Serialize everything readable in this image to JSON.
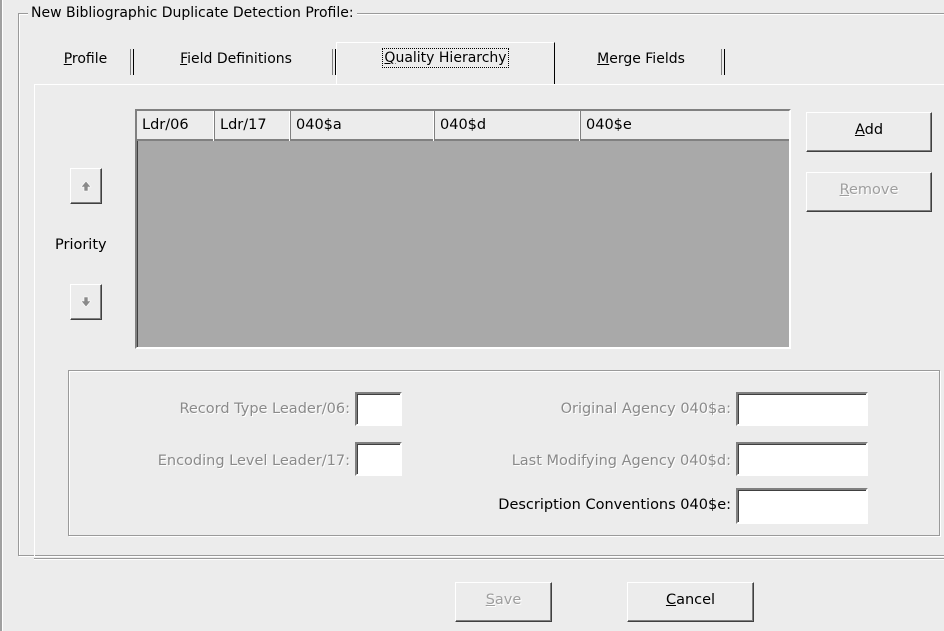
{
  "group_title": "New Bibliographic Duplicate Detection Profile:",
  "tabs": [
    {
      "label": "Profile",
      "mnemonic": "P",
      "rest": "rofile"
    },
    {
      "label": "Field Definitions",
      "mnemonic": "F",
      "rest": "ield Definitions"
    },
    {
      "label": "Quality Hierarchy",
      "mnemonic": "Q",
      "rest": "uality Hierarchy"
    },
    {
      "label": "Merge Fields",
      "mnemonic": "M",
      "rest": "erge Fields"
    }
  ],
  "active_tab": "Quality Hierarchy",
  "grid": {
    "columns": [
      "Ldr/06",
      "Ldr/17",
      "040$a",
      "040$d",
      "040$e"
    ],
    "rows": []
  },
  "priority_label": "Priority",
  "buttons": {
    "add": {
      "mnemonic": "A",
      "rest": "dd",
      "label": "Add"
    },
    "remove": {
      "mnemonic": "R",
      "rest": "emove",
      "label": "Remove"
    },
    "save": {
      "mnemonic": "S",
      "rest": "ave",
      "label": "Save"
    },
    "cancel": {
      "mnemonic": "C",
      "rest": "ancel",
      "label": "Cancel"
    }
  },
  "fields": {
    "record_type_label": "Record Type Leader/06:",
    "record_type_value": "",
    "encoding_level_label": "Encoding Level Leader/17:",
    "encoding_level_value": "",
    "original_agency_label": "Original Agency 040$a:",
    "original_agency_value": "",
    "last_modifying_label": "Last Modifying Agency 040$d:",
    "last_modifying_value": "",
    "description_conventions_label": "Description Conventions 040$e:",
    "description_conventions_value": ""
  },
  "colors": {
    "dialog_bg": "#ececec",
    "grid_bg": "#a9a9a9",
    "disabled_text": "#8a8a8a"
  },
  "icons": [
    "up-arrow-icon",
    "down-arrow-icon"
  ]
}
